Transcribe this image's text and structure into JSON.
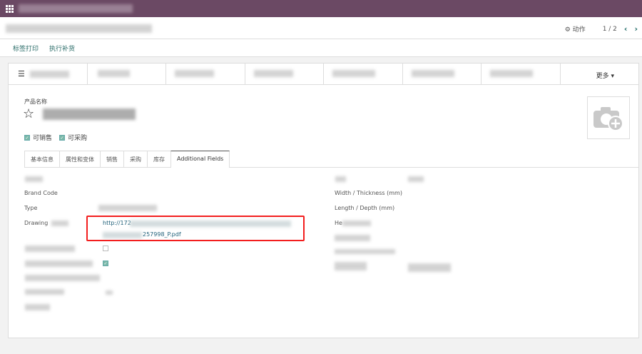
{
  "topbar": {
    "icon": "apps-grid-icon"
  },
  "control_panel": {
    "action_label": "动作",
    "pager": "1 / 2",
    "prev_icon": "chevron-left-icon",
    "next_icon": "chevron-right-icon"
  },
  "buttons": {
    "print_labels": "标签打印",
    "replenish": "执行补货"
  },
  "stats": {
    "more_label": "更多"
  },
  "product": {
    "name_label": "产品名称",
    "can_sell": "可销售",
    "can_purchase": "可采购"
  },
  "tabs": [
    "基本信息",
    "属性和变体",
    "销售",
    "采购",
    "库存",
    "Additional Fields"
  ],
  "fields_left": {
    "brand_code": "Brand Code",
    "type": "Type",
    "drawing": "Drawing",
    "drawing_link_start": "http://172",
    "drawing_link_end": "257998_P.pdf"
  },
  "fields_right": {
    "width": "Width / Thickness (mm)",
    "length": "Length / Depth (mm)",
    "height_prefix": "He"
  },
  "colors": {
    "topbar": "#6b4964",
    "accent": "#2a6c68",
    "highlight": "#f31e1e"
  }
}
